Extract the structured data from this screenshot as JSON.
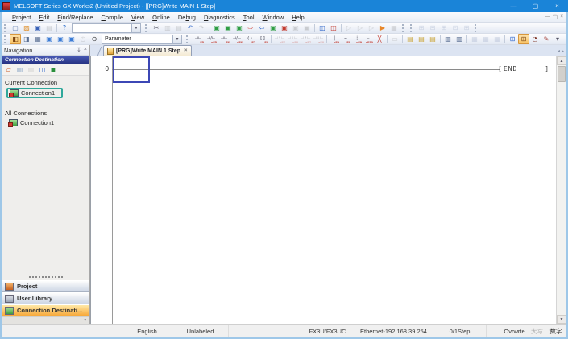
{
  "window": {
    "title": "MELSOFT Series GX Works2 (Untitled Project) - [[PRG]Write MAIN 1 Step]",
    "minimize": "—",
    "restore": "▢",
    "close": "×"
  },
  "menubar": {
    "items": [
      {
        "label": "Project",
        "u": 0
      },
      {
        "label": "Edit",
        "u": 0
      },
      {
        "label": "Find/Replace",
        "u": 0
      },
      {
        "label": "Compile",
        "u": 0
      },
      {
        "label": "View",
        "u": 0
      },
      {
        "label": "Online",
        "u": 0
      },
      {
        "label": "Debug",
        "u": 2
      },
      {
        "label": "Diagnostics",
        "u": 0
      },
      {
        "label": "Tool",
        "u": 0
      },
      {
        "label": "Window",
        "u": 0
      },
      {
        "label": "Help",
        "u": 0
      }
    ],
    "mdi": {
      "minimize": "—",
      "restore": "▢",
      "close": "×"
    }
  },
  "toolbars": {
    "row1a": [
      {
        "grip": true
      },
      {
        "n": "new-project-icon",
        "g": "▢",
        "c": "#6d87b5"
      },
      {
        "n": "open-project-icon",
        "g": "▨",
        "c": "#e0912e"
      },
      {
        "n": "save-project-icon",
        "g": "▣",
        "c": "#3a62b8"
      },
      {
        "n": "print-icon",
        "g": "▤",
        "c": "#888",
        "cls": "disabled"
      },
      {
        "sep": true
      },
      {
        "n": "help-icon",
        "g": "?",
        "c": "#1a62c8"
      }
    ],
    "combo1": {
      "value": "",
      "arrow": "▼"
    },
    "row1b": [
      {
        "grip": true
      },
      {
        "n": "cut-icon",
        "g": "✂",
        "c": "#445"
      },
      {
        "n": "copy-icon",
        "g": "▥",
        "c": "#888",
        "cls": "disabled"
      },
      {
        "n": "paste-icon",
        "g": "▤",
        "c": "#888",
        "cls": "disabled"
      },
      {
        "n": "undo-icon",
        "g": "↶",
        "c": "#2a62c8"
      },
      {
        "n": "redo-icon",
        "g": "↷",
        "c": "#888",
        "cls": "disabled"
      },
      {
        "sep": true
      },
      {
        "n": "read-from-plc-icon",
        "g": "▣",
        "c": "#2f9e44"
      },
      {
        "n": "write-to-plc-icon",
        "g": "▣",
        "c": "#2f9e44"
      },
      {
        "n": "verify-with-plc-icon",
        "g": "▣",
        "c": "#2f9e44"
      },
      {
        "n": "transfer-write-icon",
        "g": "⇨",
        "c": "#d33a2f"
      },
      {
        "n": "transfer-read-icon",
        "g": "⇦",
        "c": "#2a62c8"
      },
      {
        "n": "monitor-mode-icon",
        "g": "▣",
        "c": "#2f9e44"
      },
      {
        "n": "monitor-write-mode-icon",
        "g": "▣",
        "c": "#c23a2f"
      },
      {
        "n": "monitor-stop-icon",
        "g": "▣",
        "c": "#888",
        "cls": "disabled"
      },
      {
        "n": "monitor-step-icon",
        "g": "▣",
        "c": "#888",
        "cls": "disabled"
      },
      {
        "sep": true
      },
      {
        "n": "device-display-icon",
        "g": "◫",
        "c": "#2a62c8"
      },
      {
        "n": "device-test-icon",
        "g": "◫",
        "c": "#c23a2f"
      },
      {
        "sep": true
      },
      {
        "n": "step-execution-icon",
        "g": "▷",
        "c": "#888",
        "cls": "disabled"
      },
      {
        "n": "break-execution-icon",
        "g": "▷",
        "c": "#888",
        "cls": "disabled"
      },
      {
        "n": "skip-execution-icon",
        "g": "▷",
        "c": "#888",
        "cls": "disabled"
      },
      {
        "n": "simulation-icon",
        "g": "▶",
        "c": "#e8872a"
      },
      {
        "n": "sampling-trace-icon",
        "g": "▦",
        "c": "#888",
        "cls": "disabled"
      },
      {
        "grip": true
      }
    ],
    "row1c": [
      {
        "grip": true
      },
      {
        "n": "statement-list-icon",
        "g": "⊞",
        "c": "#8899bb",
        "cls": "disabled"
      },
      {
        "n": "device-comment-list-icon",
        "g": "⊟",
        "c": "#8899bb",
        "cls": "disabled"
      },
      {
        "n": "cross-reference-icon",
        "g": "⊞",
        "c": "#8899bb",
        "cls": "disabled"
      },
      {
        "n": "device-list-icon",
        "g": "⊡",
        "c": "#8899bb",
        "cls": "disabled"
      },
      {
        "n": "watch-register-icon",
        "g": "⊞",
        "c": "#8899bb",
        "cls": "disabled"
      },
      {
        "grip": true
      }
    ],
    "row2a": [
      {
        "grip": true
      },
      {
        "n": "navigation-window-icon",
        "g": "◧",
        "c": "#7a420e",
        "cls": "active"
      },
      {
        "n": "element-selection-window-icon",
        "g": "◨",
        "c": "#5a6f93"
      },
      {
        "n": "output-window-icon",
        "g": "▦",
        "c": "#5a6f93"
      },
      {
        "n": "docking-window-1-icon",
        "g": "▣",
        "c": "#3a7bd5"
      },
      {
        "n": "docking-window-2-icon",
        "g": "▣",
        "c": "#3a7bd5"
      },
      {
        "n": "docking-window-3-icon",
        "g": "▣",
        "c": "#3a7bd5"
      },
      {
        "n": "watch-window-icon",
        "g": "◷",
        "c": "#888",
        "cls": "disabled"
      },
      {
        "n": "find-icon",
        "g": "⊙",
        "c": "#333"
      }
    ],
    "combo2": {
      "value": "Parameter",
      "arrow": "▼"
    },
    "row2b": [
      {
        "grip": true
      },
      {
        "n": "open-contact-icon",
        "g": "⊣⊢",
        "c": "#223",
        "sub": "F5",
        "w": 16
      },
      {
        "n": "close-contact-icon",
        "g": "⊣/⊢",
        "c": "#223",
        "sub": "sF5",
        "w": 16
      },
      {
        "n": "open-branch-icon",
        "g": "⊣⊢",
        "c": "#223",
        "sub": "F6",
        "w": 16
      },
      {
        "n": "close-branch-icon",
        "g": "⊣/⊢",
        "c": "#223",
        "sub": "sF6",
        "w": 16
      },
      {
        "n": "coil-icon",
        "g": "( )",
        "c": "#223",
        "sub": "F7",
        "w": 16
      },
      {
        "n": "application-instruction-icon",
        "g": "[ ]",
        "c": "#223",
        "sub": "F8",
        "w": 16
      },
      {
        "sep": true
      },
      {
        "n": "rising-pulse-icon",
        "g": "⊣↑⊢",
        "c": "#223",
        "sub": "sF7",
        "w": 16,
        "cls": "disabled"
      },
      {
        "n": "falling-pulse-icon",
        "g": "⊣↓⊢",
        "c": "#223",
        "sub": "sF8",
        "w": 16,
        "cls": "disabled"
      },
      {
        "n": "rising-branch-icon",
        "g": "⊣↑⊢",
        "c": "#223",
        "sub": "aF7",
        "w": 16,
        "cls": "disabled"
      },
      {
        "n": "falling-branch-icon",
        "g": "⊣↓⊢",
        "c": "#223",
        "sub": "aF8",
        "w": 16,
        "cls": "disabled"
      },
      {
        "sep": true
      },
      {
        "n": "vertical-line-icon",
        "g": "│",
        "c": "#223",
        "sub": "sF9"
      },
      {
        "n": "horizontal-line-icon",
        "g": "─",
        "c": "#223",
        "sub": "F9"
      },
      {
        "n": "delete-vertical-line-icon",
        "g": "┊",
        "c": "#223",
        "sub": "cF9"
      },
      {
        "n": "delete-horizontal-line-icon",
        "g": "┄",
        "c": "#223",
        "sub": "cF10"
      },
      {
        "n": "delete-line-icon",
        "g": "╳",
        "c": "#c23a2f"
      },
      {
        "sep": true
      },
      {
        "n": "edit-line-icon",
        "g": "▭",
        "c": "#888",
        "cls": "disabled"
      },
      {
        "sep": true
      },
      {
        "n": "device-comment-edit-icon",
        "g": "▤",
        "c": "#caa63c"
      },
      {
        "n": "statement-edit-icon",
        "g": "▤",
        "c": "#caa63c"
      },
      {
        "n": "note-edit-icon",
        "g": "▤",
        "c": "#caa63c"
      },
      {
        "sep": true
      },
      {
        "n": "inline-st-icon",
        "g": "▥",
        "c": "#5a6f93"
      },
      {
        "n": "edit-block-icon",
        "g": "▥",
        "c": "#5a6f93"
      },
      {
        "sep": true
      },
      {
        "n": "read-mode-icon",
        "g": "▦",
        "c": "#8899bb",
        "cls": "disabled"
      },
      {
        "n": "write-mode-icon",
        "g": "▦",
        "c": "#8899bb",
        "cls": "disabled"
      },
      {
        "n": "monitor-read-mode-icon",
        "g": "▦",
        "c": "#8899bb",
        "cls": "disabled"
      },
      {
        "sep": true
      },
      {
        "n": "zoom-display-icon",
        "g": "⊞",
        "c": "#2a62c8"
      },
      {
        "n": "comment-display-icon",
        "g": "⊞",
        "c": "#7a420e",
        "cls": "active"
      },
      {
        "n": "statement-display-icon",
        "g": "◔",
        "c": "#833c2f"
      },
      {
        "n": "note-display-icon",
        "g": "✎",
        "c": "#a33a2f"
      },
      {
        "n": "toolbar-options-icon",
        "g": "▾",
        "c": "#556"
      }
    ]
  },
  "navigation": {
    "header": {
      "title": "Navigation",
      "pin": "↧",
      "close": "×"
    },
    "section_bar": "Connection Destination",
    "tools": [
      {
        "n": "new-connection-icon",
        "g": "▱",
        "c": "#c8571f"
      },
      {
        "n": "copy-connection-icon",
        "g": "▥",
        "c": "#7d9cc0"
      },
      {
        "n": "paste-connection-icon",
        "g": "▤",
        "c": "#999",
        "cls": "disabled"
      },
      {
        "n": "connection-info-icon",
        "g": "◫",
        "c": "#2a62c8"
      },
      {
        "n": "connection-check-icon",
        "g": "▣",
        "c": "#2a8f3c"
      }
    ],
    "current_connection_label": "Current Connection",
    "current_connection_item": "Connection1",
    "all_connections_label": "All Connections",
    "all_connections_item": "Connection1",
    "stack": {
      "project": "Project",
      "user_library": "User Library",
      "connection_destination": "Connection Destinati...",
      "chevron": "▾"
    }
  },
  "editor": {
    "tab": {
      "label": "[PRG]Write MAIN 1 Step",
      "close": "×"
    },
    "tab_scroll": {
      "left": "◂",
      "right": "▸"
    },
    "ladder": {
      "step_number": "0",
      "bracket_open": "[",
      "end_instruction": "END",
      "bracket_close": "]"
    },
    "scrollbar": {
      "up": "▲",
      "down": "▼"
    }
  },
  "statusbar": {
    "items": [
      {
        "t": "",
        "w": 150,
        "cls": "noline"
      },
      {
        "t": "English",
        "w": 62
      },
      {
        "t": "Unlabeled",
        "w": 70
      },
      {
        "t": "",
        "w": 90
      },
      {
        "t": "FX3U/FX3UC",
        "w": 66
      },
      {
        "t": "Ethernet-192.168.39.254",
        "w": 98
      },
      {
        "t": "0/1Step",
        "w": 66
      },
      {
        "t": "",
        "w": 0,
        "cls": "flex"
      },
      {
        "t": "Ovrwrte",
        "w": 36
      },
      {
        "t": "大写",
        "w": 20,
        "cls": "dim"
      },
      {
        "t": "数字",
        "w": 26,
        "cls": "noline"
      }
    ]
  }
}
